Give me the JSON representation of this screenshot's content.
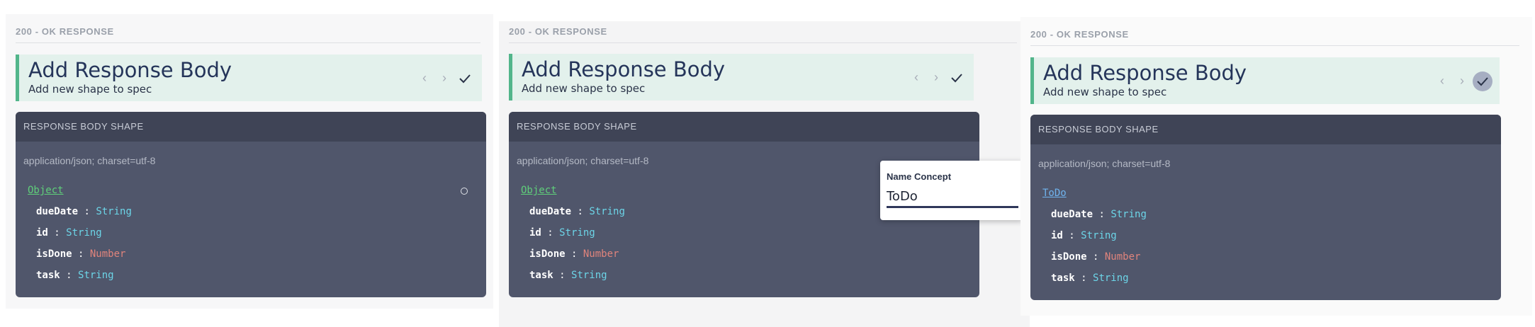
{
  "panels": [
    {
      "section_label": "200 - OK RESPONSE",
      "header": {
        "title": "Add Response Body",
        "subtitle": "Add new shape to spec"
      },
      "shape": {
        "heading": "RESPONSE BODY SHAPE",
        "content_type": "application/json; charset=utf-8",
        "root": "Object",
        "fields": [
          {
            "key": "dueDate",
            "type": "String"
          },
          {
            "key": "id",
            "type": "String"
          },
          {
            "key": "isDone",
            "type": "Number"
          },
          {
            "key": "task",
            "type": "String"
          }
        ]
      }
    },
    {
      "section_label": "200 - OK RESPONSE",
      "header": {
        "title": "Add Response Body",
        "subtitle": "Add new shape to spec"
      },
      "shape": {
        "heading": "RESPONSE BODY SHAPE",
        "content_type": "application/json; charset=utf-8",
        "root": "Object",
        "fields": [
          {
            "key": "dueDate",
            "type": "String"
          },
          {
            "key": "id",
            "type": "String"
          },
          {
            "key": "isDone",
            "type": "Number"
          },
          {
            "key": "task",
            "type": "String"
          }
        ]
      }
    },
    {
      "section_label": "200 - OK RESPONSE",
      "header": {
        "title": "Add Response Body",
        "subtitle": "Add new shape to spec"
      },
      "shape": {
        "heading": "RESPONSE BODY SHAPE",
        "content_type": "application/json; charset=utf-8",
        "root": "ToDo",
        "fields": [
          {
            "key": "dueDate",
            "type": "String"
          },
          {
            "key": "id",
            "type": "String"
          },
          {
            "key": "isDone",
            "type": "Number"
          },
          {
            "key": "task",
            "type": "String"
          }
        ]
      }
    }
  ],
  "popover": {
    "label": "Name Concept",
    "value": "ToDo"
  },
  "icons": {
    "prev": "chevron-left-icon",
    "next": "chevron-right-icon",
    "confirm": "check-icon"
  },
  "colors": {
    "accent_green": "#52b58b",
    "header_bg": "#e3f1ec",
    "card_bg": "#50566b",
    "type_string": "#6cd5e8",
    "type_number": "#e0847c",
    "root_object": "#5fcf7a",
    "root_named": "#6fb3ee"
  }
}
